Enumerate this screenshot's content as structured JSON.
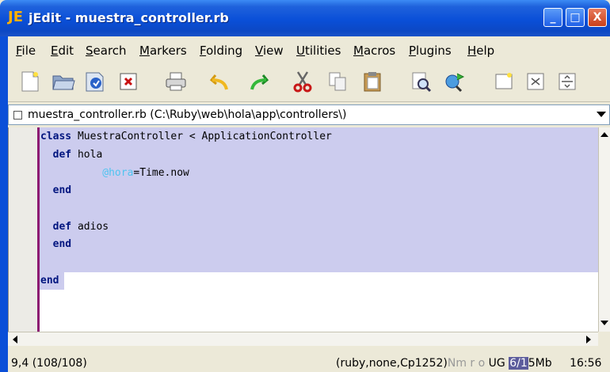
{
  "window": {
    "app_icon": "JE",
    "title": "jEdit - muestra_controller.rb",
    "minimize": "_",
    "maximize": "□",
    "close": "X"
  },
  "menu": [
    "File",
    "Edit",
    "Search",
    "Markers",
    "Folding",
    "View",
    "Utilities",
    "Macros",
    "Plugins",
    "Help"
  ],
  "toolbar_icons": [
    "new-file-icon",
    "open-folder-icon",
    "reload-icon",
    "close-buffer-icon",
    "print-icon",
    "undo-icon",
    "redo-icon",
    "cut-icon",
    "copy-icon",
    "paste-icon",
    "find-icon",
    "find-next-icon",
    "new-view-icon",
    "split-horizontal-icon",
    "unsplit-icon"
  ],
  "buffer": {
    "path": "muestra_controller.rb (C:\\Ruby\\web\\hola\\app\\controllers\\)"
  },
  "code": {
    "line1_kw": "class",
    "line1_rest": " MuestraController < ApplicationController",
    "line2_kw": "  def",
    "line2_rest": " hola",
    "line3_indent": "          ",
    "line3_ivar": "@hora",
    "line3_rest": "=Time.now",
    "line4_kw": "  end",
    "line6_kw": "  def",
    "line6_rest": " adios",
    "line7_kw": "  end",
    "line9_kw": "end"
  },
  "status": {
    "position": "9,4 (108/108)",
    "mode": "(ruby,none,Cp1252)",
    "flags": "Nm r o",
    "ug": "UG",
    "memory_bar": "6/1",
    "memory_rest": "5Mb",
    "clock": "16:56"
  }
}
